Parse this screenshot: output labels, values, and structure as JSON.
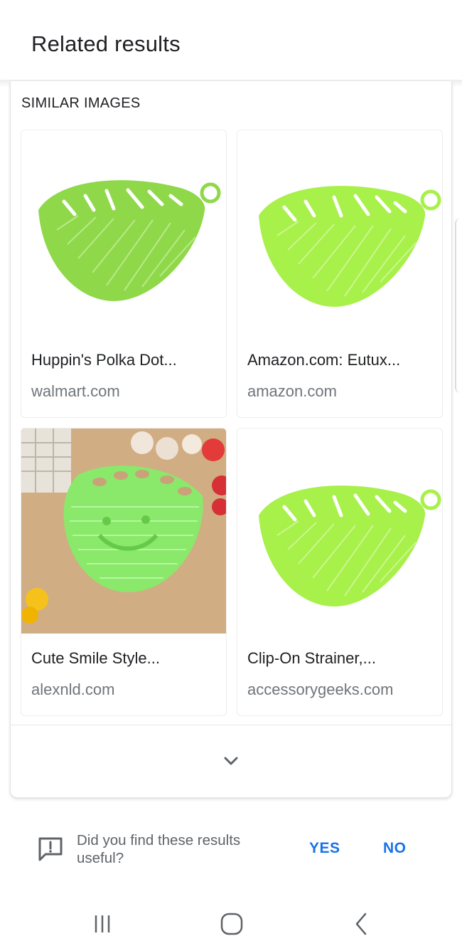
{
  "header": {
    "title": "Related results"
  },
  "section": {
    "title": "SIMILAR IMAGES"
  },
  "results": [
    {
      "title": "Huppin's Polka Dot...",
      "source": "walmart.com",
      "image": "green-leaf-strainer-image"
    },
    {
      "title": "Amazon.com: Eutux...",
      "source": "amazon.com",
      "image": "lime-leaf-strainer-image"
    },
    {
      "title": "Cute Smile Style...",
      "source": "alexnld.com",
      "image": "smile-strainer-photo"
    },
    {
      "title": "Clip-On Strainer,...",
      "source": "accessorygeeks.com",
      "image": "lime-leaf-strainer-image"
    }
  ],
  "expand": {
    "icon": "chevron-down-icon"
  },
  "feedback": {
    "icon": "feedback-icon",
    "question": "Did you find these results useful?",
    "yes_label": "YES",
    "no_label": "NO"
  },
  "navbar": {
    "recents_icon": "recents-icon",
    "home_icon": "home-icon",
    "back_icon": "back-icon"
  },
  "colors": {
    "accent": "#1a73e8",
    "text": "#202124",
    "secondary": "#70757a",
    "leaf_green": "#8fd84a",
    "lime_green": "#a8f04a"
  }
}
